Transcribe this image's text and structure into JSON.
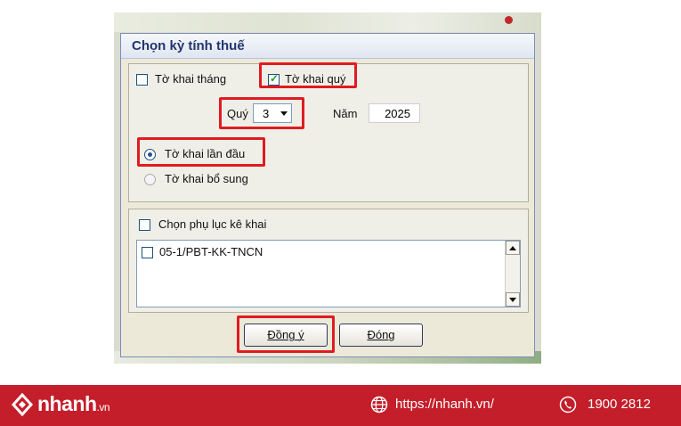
{
  "dialog": {
    "title": "Chọn kỳ tính thuế",
    "monthly_label": "Tờ khai tháng",
    "quarterly_label": "Tờ khai quý",
    "quarter_label": "Quý",
    "quarter_value": "3",
    "year_label": "Năm",
    "year_value": "2025",
    "first_time_label": "Tờ khai lần đầu",
    "supplement_label": "Tờ khai bổ sung",
    "appendix_label": "Chọn phụ lục kê khai",
    "appendix_items": [
      "05-1/PBT-KK-TNCN"
    ],
    "ok_button": "Đồng ý",
    "close_button": "Đóng",
    "monthly_checked": false,
    "quarterly_checked": true,
    "first_time_selected": true,
    "appendix_checked": false
  },
  "footer": {
    "brand": "nhanh",
    "brand_suffix": ".vn",
    "website": "https://nhanh.vn/",
    "phone": "1900 2812",
    "background": "#c41e2a"
  },
  "colors": {
    "highlight": "#e01b22",
    "title_text": "#22356b"
  }
}
